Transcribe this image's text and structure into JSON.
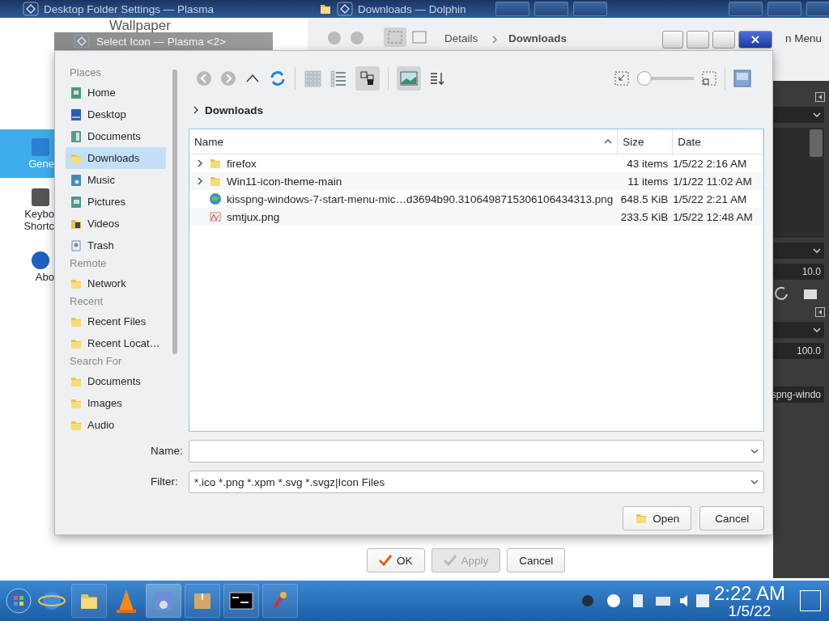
{
  "top_bar": {
    "settings_title": "Desktop Folder Settings — Plasma",
    "dolphin_title": "Downloads — Dolphin"
  },
  "settings_window": {
    "heading": "Wallpaper",
    "sidebar": [
      {
        "label": "Gene",
        "selected": true
      },
      {
        "label": "Keybo Shortc",
        "selected": false
      },
      {
        "label": "Abo",
        "selected": false
      }
    ],
    "buttons": [
      {
        "label": "OK",
        "disabled": false
      },
      {
        "label": "Apply",
        "disabled": true
      },
      {
        "label": "Cancel",
        "disabled": false
      }
    ]
  },
  "dolphin_window": {
    "view_mode": "Details",
    "path": "Downloads",
    "menu_fragment": "n Menu"
  },
  "side_panel": {
    "brush_size": "10.0",
    "opacity": "100.0",
    "image_name": "spng-windo"
  },
  "dialog": {
    "title": "Select Icon — Plasma <2>",
    "places": [
      {
        "heading": "Places",
        "items": [
          {
            "label": "Home",
            "selected": false
          },
          {
            "label": "Desktop",
            "selected": false
          },
          {
            "label": "Documents",
            "selected": false
          },
          {
            "label": "Downloads",
            "selected": true
          },
          {
            "label": "Music",
            "selected": false
          },
          {
            "label": "Pictures",
            "selected": false
          },
          {
            "label": "Videos",
            "selected": false
          },
          {
            "label": "Trash",
            "selected": false
          }
        ]
      },
      {
        "heading": "Remote",
        "items": [
          {
            "label": "Network",
            "selected": false
          }
        ]
      },
      {
        "heading": "Recent",
        "items": [
          {
            "label": "Recent Files",
            "selected": false
          },
          {
            "label": "Recent Locat…",
            "selected": false
          }
        ]
      },
      {
        "heading": "Search For",
        "items": [
          {
            "label": "Documents",
            "selected": false
          },
          {
            "label": "Images",
            "selected": false
          },
          {
            "label": "Audio",
            "selected": false
          }
        ]
      }
    ],
    "zoom": {
      "level": 0
    },
    "breadcrumb": "Downloads",
    "columns": [
      "Name",
      "Size",
      "Date"
    ],
    "rows": [
      {
        "kind": "folder",
        "name": "firefox",
        "size": "43 items",
        "date": "1/5/22 2:16 AM"
      },
      {
        "kind": "folder",
        "name": "Win11-icon-theme-main",
        "size": "11 items",
        "date": "1/1/22 11:02 AM"
      },
      {
        "kind": "web-image",
        "name": "kisspng-windows-7-start-menu-mic…d3694b90.3106498715306106434313.png",
        "size": "648.5 KiB",
        "date": "1/5/22 2:21 AM"
      },
      {
        "kind": "image",
        "name": "smtjux.png",
        "size": "233.5 KiB",
        "date": "1/5/22 12:48 AM"
      }
    ],
    "name_label": "Name:",
    "filter_label": "Filter:",
    "filter_value": "*.ico *.png *.xpm *.svg *.svgz|Icon Files",
    "buttons": [
      {
        "label": "Open"
      },
      {
        "label": "Cancel"
      }
    ]
  },
  "taskbar": {
    "time": "2:22 AM",
    "date": "1/5/22"
  }
}
